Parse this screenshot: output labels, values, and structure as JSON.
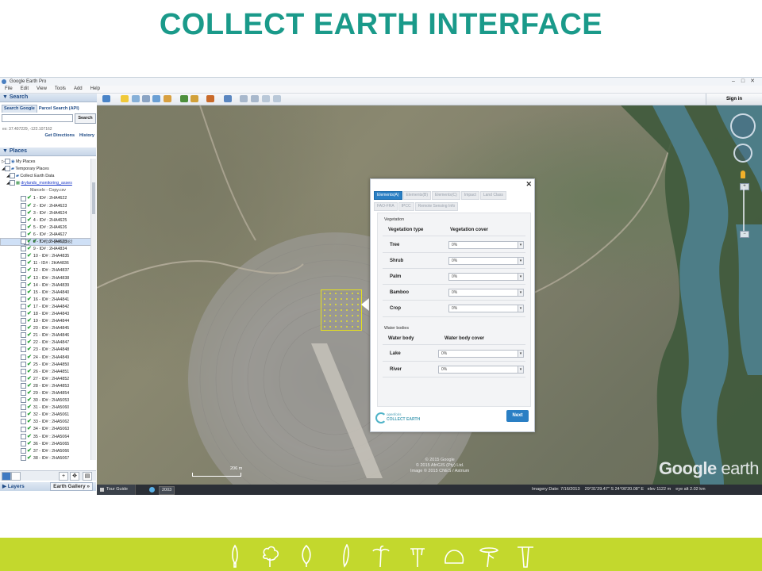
{
  "slide_title": "COLLECT EARTH INTERFACE",
  "window": {
    "title": "Google Earth Pro",
    "controls": [
      "–",
      "□",
      "✕"
    ],
    "menu": [
      "File",
      "Edit",
      "View",
      "Tools",
      "Add",
      "Help"
    ]
  },
  "left_panel": {
    "search_header": "▼ Search",
    "search_tabs": [
      "Search Google",
      "Parcel Search (API)"
    ],
    "search_input_value": "",
    "search_button": "Search",
    "search_hint": "ex: 37.407229, -122.107162",
    "links": [
      "Get Directions",
      "History"
    ],
    "places_header": "▼ Places",
    "tree": {
      "my_places": "My Places",
      "temporary_places": "Temporary Places",
      "collect_earth_data": "Collect Earth Data",
      "drylands": "drylands_monitoring_asses",
      "csv": "Marcelo - Copy.csv",
      "plots": [
        "1 - ID# : 2HA4622",
        "2 - ID# : 2HA4623",
        "3 - ID# : 2HA4624",
        "4 - ID# : 2HA4625",
        "5 - ID# : 2HA4626",
        "6 - ID# : 2HA4627",
        "7 - ID# : 2XX31882",
        "8 - ID# : 2HA4628",
        "9 - ID# : 2HA4834",
        "10 - ID# : 2HA4835",
        "11 - ID# : 2HA4836",
        "12 - ID# : 2HA4837",
        "13 - ID# : 2HA4838",
        "14 - ID# : 2HA4839",
        "15 - ID# : 2HA4840",
        "16 - ID# : 2HA4841",
        "17 - ID# : 2HA4842",
        "18 - ID# : 2HA4843",
        "19 - ID# : 2HA4844",
        "20 - ID# : 2HA4845",
        "21 - ID# : 2HA4846",
        "22 - ID# : 2HA4847",
        "23 - ID# : 2HA4848",
        "24 - ID# : 2HA4849",
        "25 - ID# : 2HA4850",
        "26 - ID# : 2HA4851",
        "27 - ID# : 2HA4852",
        "28 - ID# : 2HA4853",
        "29 - ID# : 2HA4854",
        "30 - ID# : 2HA5053",
        "31 - ID# : 2HA5060",
        "32 - ID# : 2HA5061",
        "33 - ID# : 2HA5062",
        "34 - ID# : 2HA5063",
        "35 - ID# : 2HA5064",
        "36 - ID# : 2HA5065",
        "37 - ID# : 2HA5066",
        "38 - ID# : 2HA5067"
      ],
      "selected_index": 6
    },
    "layers_header": "▶ Layers",
    "earth_gallery": "Earth Gallery »"
  },
  "toolbar": {
    "sign_in": "Sign in"
  },
  "map": {
    "scale_label": "206 m",
    "copyright_lines": [
      "© 2015 Google",
      "© 2015 AfriGIS (Pty) Ltd.",
      "Image © 2015 CNES / Astrium"
    ],
    "logo_text": "Google",
    "logo_text2": "earth"
  },
  "dialog": {
    "close": "✕",
    "tabs": [
      "Elements(A)",
      "Elements(B)",
      "Elements(C)",
      "Impact",
      "Land Class",
      "FAO-FRA",
      "IPCC",
      "Remote Sensing Info"
    ],
    "active_tab": "Elements(A)",
    "vegetation_section": "Vegetation",
    "veg_col1": "Vegetation type",
    "veg_col2": "Vegetation cover",
    "veg_rows": [
      {
        "label": "Tree",
        "value": "0%"
      },
      {
        "label": "Shrub",
        "value": "0%"
      },
      {
        "label": "Palm",
        "value": "0%"
      },
      {
        "label": "Bamboo",
        "value": "0%"
      },
      {
        "label": "Crop",
        "value": "0%"
      }
    ],
    "water_section": "Water bodies",
    "water_col1": "Water body",
    "water_col2": "Water body cover",
    "water_rows": [
      {
        "label": "Lake",
        "value": "0%"
      },
      {
        "label": "River",
        "value": "0%"
      }
    ],
    "logo_line1": "openforis",
    "logo_line2": "COLLECT EARTH",
    "next_button": "Next"
  },
  "statusbar": {
    "tour_guide": "Tour Guide",
    "historical_year": "2003",
    "imagery_date": "Imagery Date: 7/16/2013",
    "coords": "29°31'29.47\" S  24°00'20.08\" E",
    "elev": "elev  1122 m",
    "eye_alt": "eye alt   2.02 km"
  },
  "colors": {
    "title": "#1a9a8a",
    "footer": "#c3d82d",
    "active_tab": "#2a7fc4",
    "plot_outline": "#e5e01e"
  }
}
